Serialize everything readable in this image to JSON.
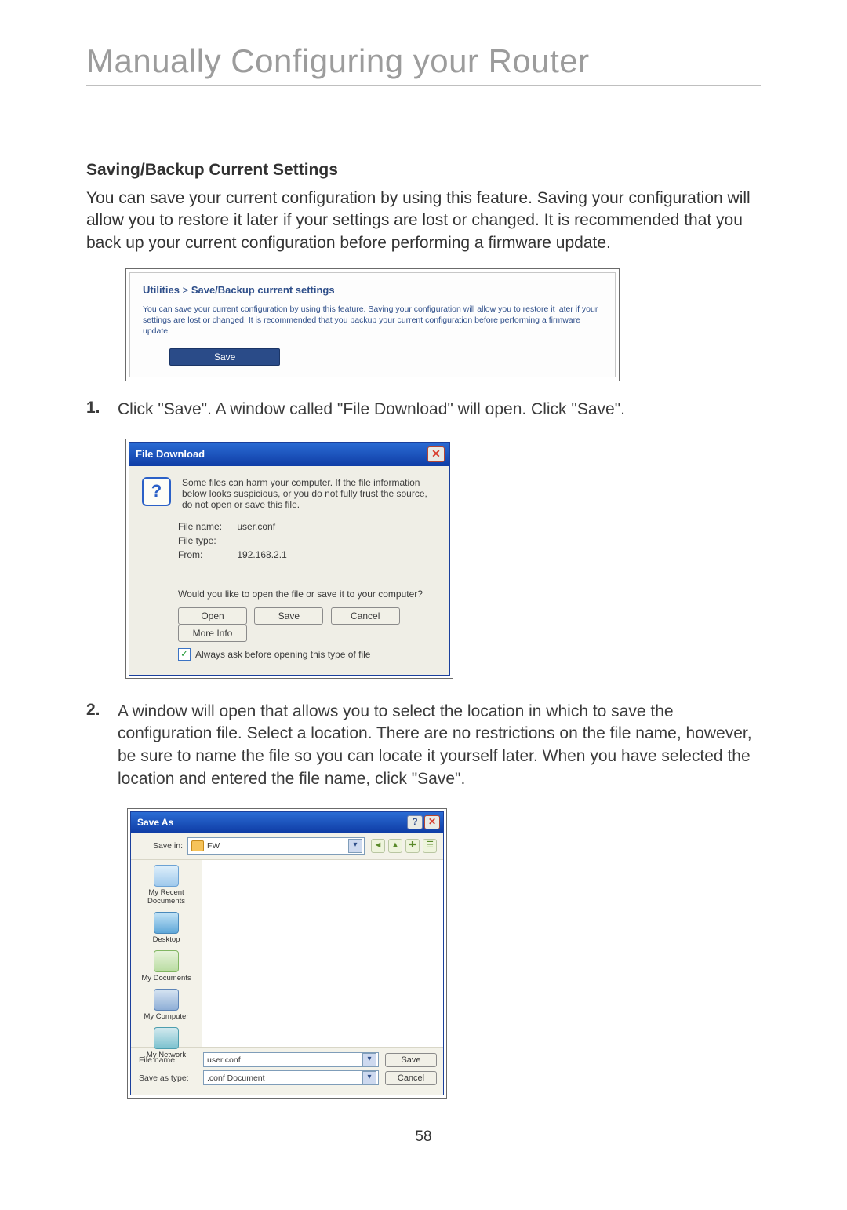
{
  "page": {
    "title": "Manually Configuring your Router",
    "number": "58"
  },
  "section": {
    "heading": "Saving/Backup Current Settings",
    "intro": "You can save your current configuration by using this feature. Saving your configuration will allow you to restore it later if your settings are lost or changed. It is recommended that you back up your current configuration before performing a firmware update."
  },
  "panel": {
    "breadcrumb_a": "Utilities",
    "breadcrumb_sep": ">",
    "breadcrumb_b": "Save/Backup current settings",
    "desc": "You can save your current configuration by using this feature. Saving your configuration will allow you to restore it later if your settings are lost or changed. It is recommended that you backup your current configuration before performing a firmware update.",
    "save_label": "Save"
  },
  "steps": {
    "s1_num": "1.",
    "s1_text": "Click \"Save\". A window called \"File Download\" will open. Click \"Save\".",
    "s2_num": "2.",
    "s2_text": "A window will open that allows you to select the location in which to save the configuration file. Select a location. There are no restrictions on the file name, however, be sure to name the file so you can locate it yourself later. When you have selected the location and entered the file name, click \"Save\"."
  },
  "file_download": {
    "title": "File Download",
    "icon": "?",
    "warning": "Some files can harm your computer. If the file information below looks suspicious, or you do not fully trust the source, do not open or save this file.",
    "filename_label": "File name:",
    "filename_value": "user.conf",
    "filetype_label": "File type:",
    "filetype_value": "",
    "from_label": "From:",
    "from_value": "192.168.2.1",
    "question": "Would you like to open the file or save it to your computer?",
    "btn_open": "Open",
    "btn_save": "Save",
    "btn_cancel": "Cancel",
    "btn_more": "More Info",
    "always_ask": "Always ask before opening this type of file"
  },
  "save_as": {
    "title": "Save As",
    "save_in_label": "Save in:",
    "save_in_value": "FW",
    "places": {
      "recent": "My Recent Documents",
      "desktop": "Desktop",
      "mydocs": "My Documents",
      "mycomp": "My Computer",
      "mynet": "My Network"
    },
    "filename_label": "File name:",
    "filename_value": "user.conf",
    "saveastype_label": "Save as type:",
    "saveastype_value": ".conf Document",
    "btn_save": "Save",
    "btn_cancel": "Cancel"
  }
}
